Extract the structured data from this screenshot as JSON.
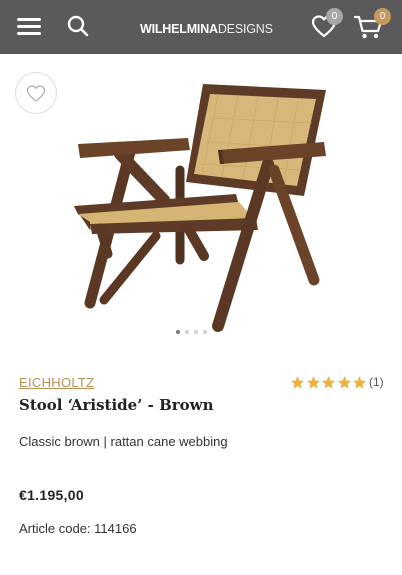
{
  "header": {
    "logo_bold": "WILHELMINA",
    "logo_light": "DESIGNS",
    "wishlist_count": "0",
    "cart_count": "0",
    "menu_icon": "hamburger-icon",
    "search_icon": "search-icon",
    "wishlist_icon": "heart-icon",
    "cart_icon": "cart-icon"
  },
  "gallery": {
    "image_count": 4,
    "active_index": 0
  },
  "product": {
    "brand": "EICHHOLTZ",
    "title": "Stool ‘Aristide’ - Brown",
    "rating": 5,
    "rating_max": 5,
    "review_count": "(1)",
    "description": "Classic brown | rattan cane webbing",
    "price": "€1.195,00",
    "article_label": "Article code:",
    "article_code": "114166"
  },
  "colors": {
    "header_bg": "#5a5a5a",
    "accent_gold": "#b89256",
    "star": "#e8b23c",
    "cart_badge": "#c79a5b",
    "wood": "#5e3b26",
    "cane": "#d9b97f"
  }
}
